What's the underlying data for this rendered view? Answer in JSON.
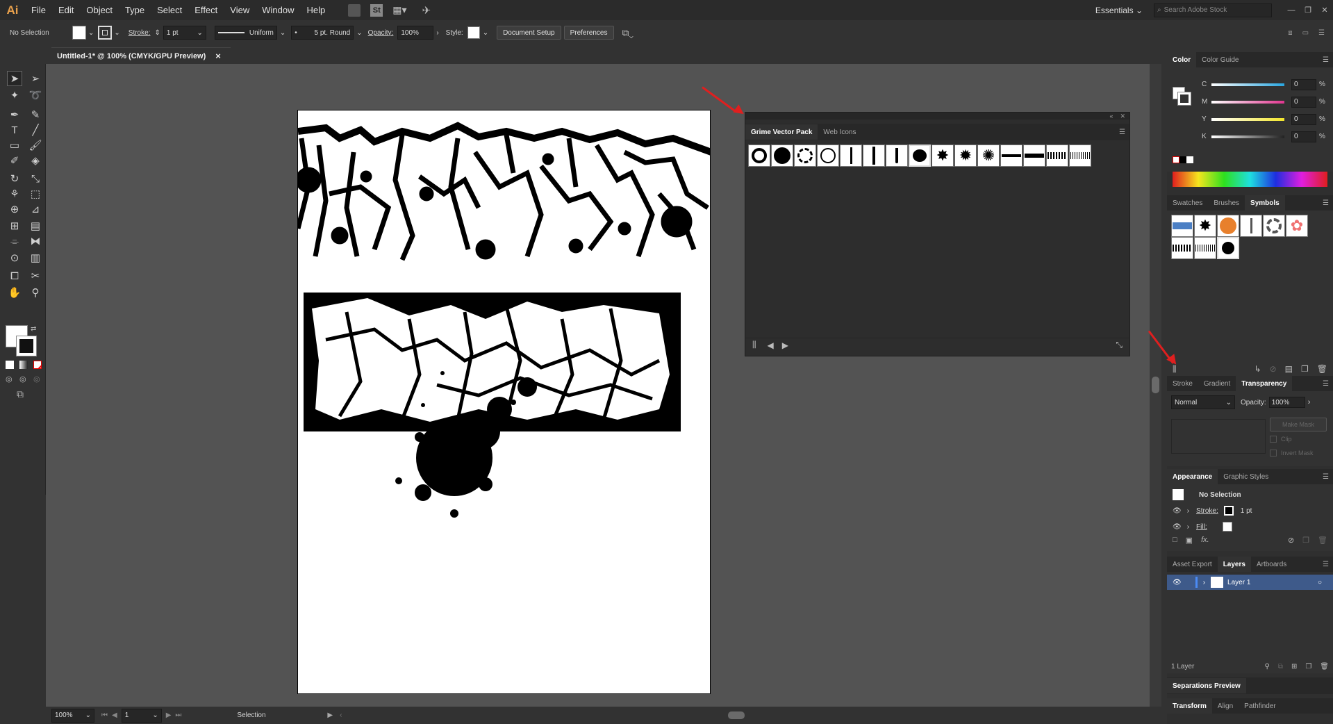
{
  "app": {
    "logo": "Ai"
  },
  "menu": [
    "File",
    "Edit",
    "Object",
    "Type",
    "Select",
    "Effect",
    "View",
    "Window",
    "Help"
  ],
  "menubar_right": {
    "st_label": "St",
    "workspace": "Essentials",
    "search_placeholder": "Search Adobe Stock"
  },
  "control": {
    "selection": "No Selection",
    "stroke_label": "Stroke:",
    "stroke_value": "1 pt",
    "profile": "Uniform",
    "brush": "5 pt. Round",
    "opacity_label": "Opacity:",
    "opacity_value": "100%",
    "style_label": "Style:",
    "doc_setup": "Document Setup",
    "preferences": "Preferences"
  },
  "document": {
    "tab_title": "Untitled-1* @ 100% (CMYK/GPU Preview)",
    "close": "×"
  },
  "symlib": {
    "tabs": [
      "Grime Vector Pack",
      "Web Icons"
    ],
    "active_tab": "Grime Vector Pack",
    "symbol_count": 15
  },
  "color_panel": {
    "tabs": [
      "Color",
      "Color Guide"
    ],
    "channels": [
      {
        "name": "C",
        "value": "0",
        "pct": "%",
        "color": "#29a6e0"
      },
      {
        "name": "M",
        "value": "0",
        "pct": "%",
        "color": "#e0358f"
      },
      {
        "name": "Y",
        "value": "0",
        "pct": "%",
        "color": "#f2e52b"
      },
      {
        "name": "K",
        "value": "0",
        "pct": "%",
        "color": "#9a9a9a"
      }
    ]
  },
  "symbols_panel": {
    "tabs": [
      "Swatches",
      "Brushes",
      "Symbols"
    ],
    "active": "Symbols"
  },
  "transparency_panel": {
    "tabs": [
      "Stroke",
      "Gradient",
      "Transparency"
    ],
    "active": "Transparency",
    "blend": "Normal",
    "opacity_label": "Opacity:",
    "opacity_value": "100%",
    "make_mask": "Make Mask",
    "clip": "Clip",
    "invert_mask": "Invert Mask"
  },
  "appearance_panel": {
    "tabs": [
      "Appearance",
      "Graphic Styles"
    ],
    "title": "No Selection",
    "stroke_label": "Stroke:",
    "stroke_value": "1 pt",
    "fill_label": "Fill:"
  },
  "layers_panel": {
    "tabs": [
      "Asset Export",
      "Layers",
      "Artboards"
    ],
    "active": "Layers",
    "layer_name": "Layer 1",
    "count": "1 Layer"
  },
  "separations": {
    "title": "Separations Preview"
  },
  "bottom_tabs": [
    "Transform",
    "Align",
    "Pathfinder"
  ],
  "status": {
    "zoom": "100%",
    "artboard": "1",
    "tool": "Selection"
  }
}
